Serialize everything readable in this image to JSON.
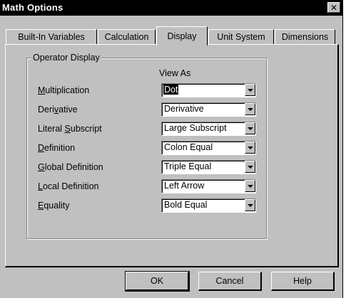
{
  "window": {
    "title": "Math Options",
    "close_glyph": "✕"
  },
  "tabs": [
    {
      "label": "Built-In Variables",
      "active": false
    },
    {
      "label": "Calculation",
      "active": false
    },
    {
      "label": "Display",
      "active": true
    },
    {
      "label": "Unit System",
      "active": false
    },
    {
      "label": "Dimensions",
      "active": false
    }
  ],
  "group": {
    "legend": "Operator Display",
    "column_header": "View As"
  },
  "rows": [
    {
      "label_pre": "",
      "label_key": "M",
      "label_post": "ultiplication",
      "value": "Dot",
      "selected": true
    },
    {
      "label_pre": "Deri",
      "label_key": "v",
      "label_post": "ative",
      "value": "Derivative",
      "selected": false
    },
    {
      "label_pre": "Literal ",
      "label_key": "S",
      "label_post": "ubscript",
      "value": "Large Subscript",
      "selected": false
    },
    {
      "label_pre": "",
      "label_key": "D",
      "label_post": "efinition",
      "value": "Colon Equal",
      "selected": false
    },
    {
      "label_pre": "",
      "label_key": "G",
      "label_post": "lobal Definition",
      "value": "Triple Equal",
      "selected": false
    },
    {
      "label_pre": "",
      "label_key": "L",
      "label_post": "ocal Definition",
      "value": "Left Arrow",
      "selected": false
    },
    {
      "label_pre": "",
      "label_key": "E",
      "label_post": "quality",
      "value": "Bold Equal",
      "selected": false
    }
  ],
  "buttons": {
    "ok": "OK",
    "cancel": "Cancel",
    "help": "Help"
  },
  "icons": {
    "close": "close-icon",
    "dropdown": "chevron-down-icon"
  }
}
